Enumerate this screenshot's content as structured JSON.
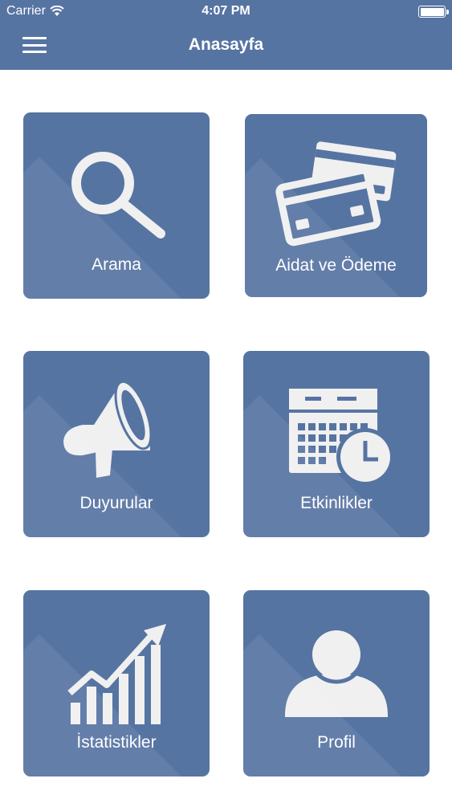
{
  "status_bar": {
    "carrier": "Carrier",
    "time": "4:07 PM"
  },
  "header": {
    "title": "Anasayfa",
    "menu_icon": "hamburger-menu-icon"
  },
  "tiles": [
    {
      "label": "Arama",
      "icon": "search-icon"
    },
    {
      "label": "Aidat ve Ödeme",
      "icon": "credit-card-icon"
    },
    {
      "label": "Duyurular",
      "icon": "megaphone-icon"
    },
    {
      "label": "Etkinlikler",
      "icon": "calendar-clock-icon"
    },
    {
      "label": "İstatistikler",
      "icon": "growth-chart-icon"
    },
    {
      "label": "Profil",
      "icon": "user-icon"
    }
  ],
  "colors": {
    "primary": "#5674a2",
    "icon": "#f0f0f0",
    "background": "#ffffff"
  }
}
